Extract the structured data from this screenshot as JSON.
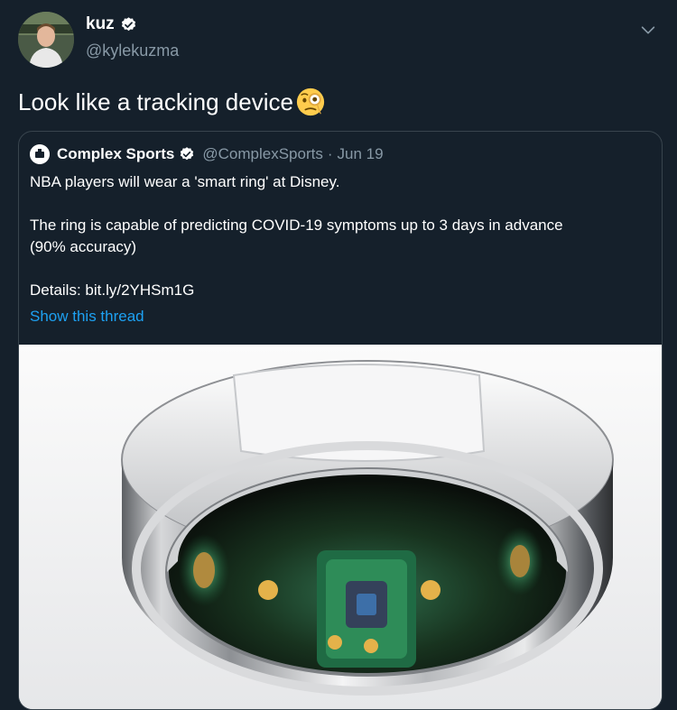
{
  "tweet": {
    "author_name": "kuz",
    "author_handle": "@kylekuzma",
    "text": "Look like a tracking device"
  },
  "quoted_tweet": {
    "author_name": "Complex Sports",
    "author_handle": "@ComplexSports",
    "separator": "·",
    "date": "Jun 19",
    "lines": [
      "NBA players will wear a 'smart ring' at Disney.",
      "The ring is capable of predicting COVID-19 symptoms up to 3 days in advance",
      "(90% accuracy)",
      "Details: bit.ly/2YHSm1G"
    ],
    "show_thread": "Show this thread"
  },
  "colors": {
    "background": "#15202b",
    "text": "#ffffff",
    "secondary_text": "#8899a6",
    "link": "#1da1f2",
    "border": "#38444d",
    "verified": "#ffffff"
  },
  "icons": [
    "verified-badge-icon",
    "chevron-down-icon",
    "face-with-monocle-emoji"
  ]
}
